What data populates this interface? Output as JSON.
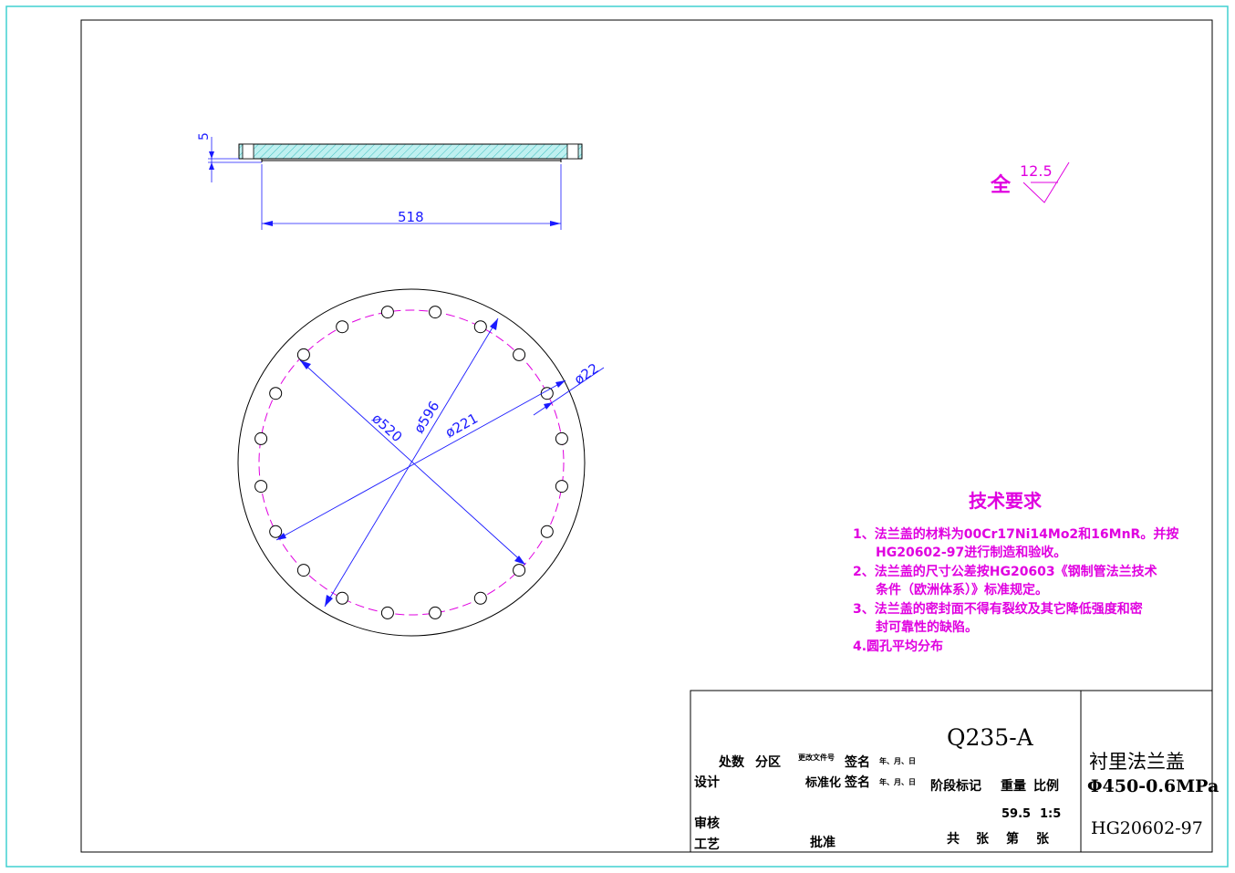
{
  "colors": {
    "outer_border": "#40d0d0",
    "line": "#000000",
    "dimension": "#1a1aff",
    "center_line": "#e000e0",
    "note_text": "#e000e0",
    "hatch_fill": "#bff0f0"
  },
  "side_view": {
    "thickness_label": "5",
    "width_label": "518"
  },
  "front_view": {
    "bolt_hole_count": 20,
    "dims": {
      "d520": "ø520",
      "d596": "ø596",
      "d221": "ø221",
      "d22": "ø22"
    }
  },
  "roughness": {
    "prefix": "全",
    "value": "12.5"
  },
  "tech_notes": {
    "title": "技术要求",
    "lines": [
      "1、法兰盖的材料为00Cr17Ni14Mo2和16MnR。并按",
      "HG20602-97进行制造和验收。",
      "2、法兰盖的尺寸公差按HG20603《钢制管法兰技术",
      "条件（欧洲体系）》标准规定。",
      "3、法兰盖的密封面不得有裂纹及其它降低强度和密",
      "封可靠性的缺陷。",
      "4.圆孔平均分布"
    ]
  },
  "title_block": {
    "material": "Q235-A",
    "part_name": "衬里法兰盖",
    "spec": "Φ450-0.6MPa",
    "standard": "HG20602-97",
    "row_labels": {
      "chushu": "处数",
      "fenqu": "分区",
      "change_doc": "更改文件号",
      "sign": "签名",
      "date": "年、月、日",
      "design": "设计",
      "standardize": "标准化",
      "sign2": "签名",
      "date2": "年、月、日",
      "review": "审核",
      "process": "工艺",
      "approve": "批准"
    },
    "stage_mark": "阶段标记",
    "weight_label": "重量",
    "scale_label": "比例",
    "weight": "59.5",
    "scale": "1:5",
    "total_label": "共",
    "sheet_unit": "张",
    "nth_label": "第",
    "sheet_unit2": "张"
  }
}
